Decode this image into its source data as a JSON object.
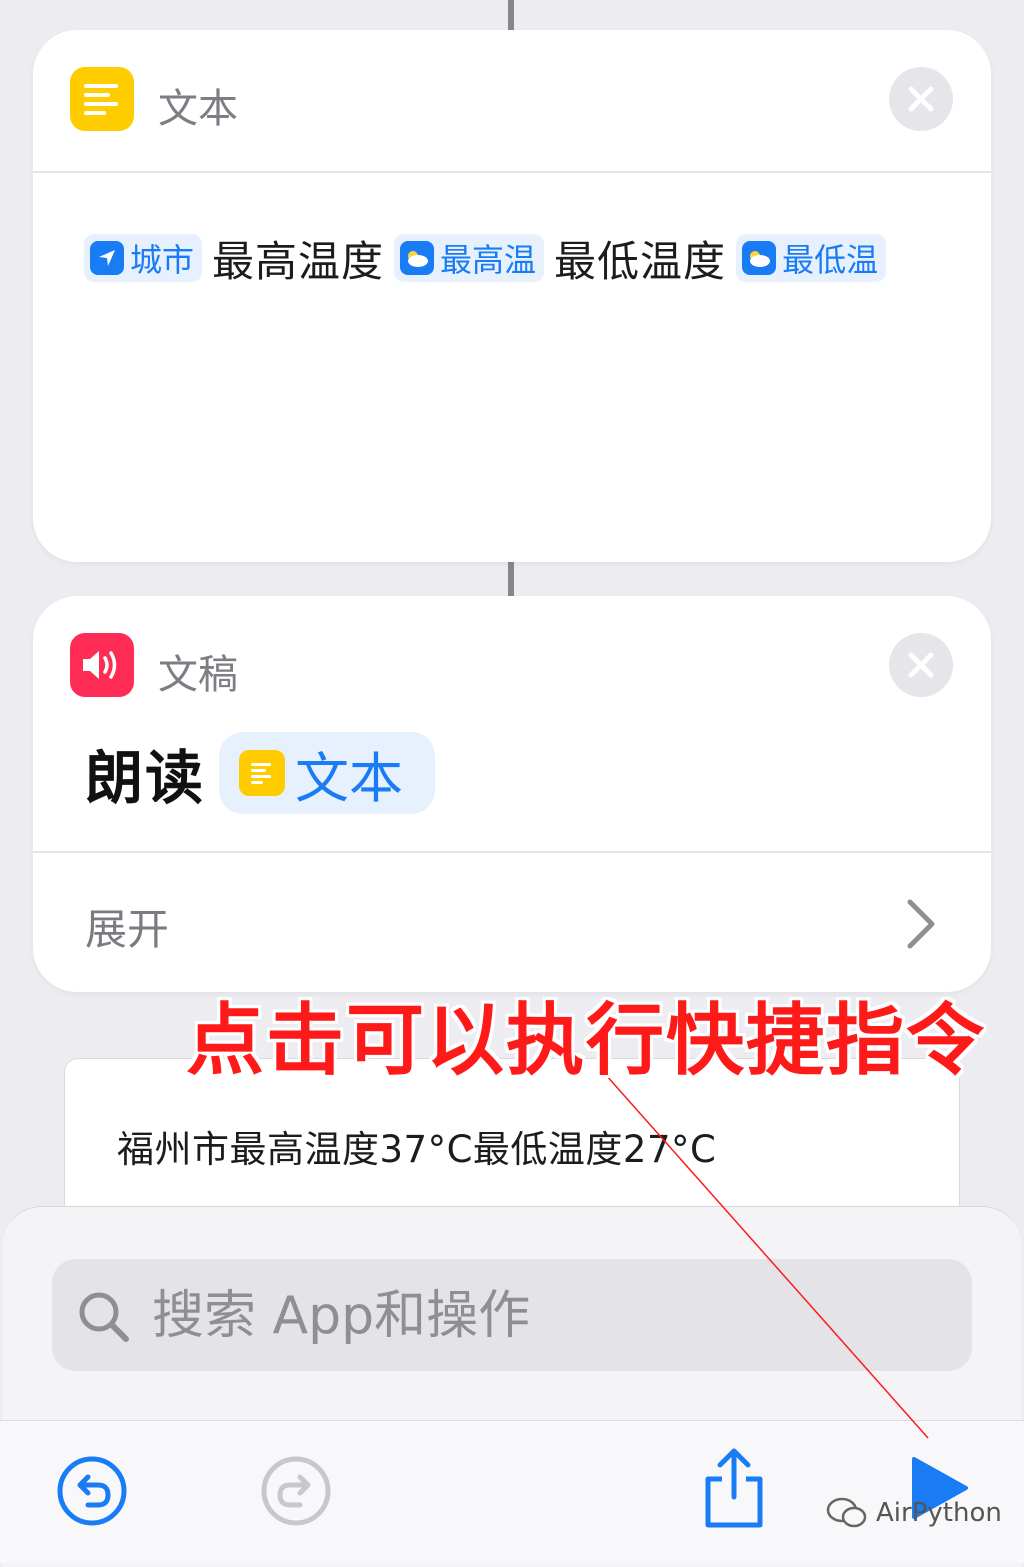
{
  "text_action": {
    "title": "文本",
    "tokens": [
      {
        "type": "chip",
        "icon": "location-arrow-icon",
        "label": "城市"
      },
      {
        "type": "text",
        "label": "最高温度"
      },
      {
        "type": "chip",
        "icon": "weather-icon",
        "label": "最高温"
      },
      {
        "type": "text",
        "label": "最低温度"
      },
      {
        "type": "chip",
        "icon": "weather-icon",
        "label": "最低温"
      }
    ]
  },
  "speak_action": {
    "title": "文稿",
    "verb": "朗读",
    "variable": "文本",
    "expand_label": "展开"
  },
  "annotation": "点击可以执行快捷指令",
  "result": {
    "text": "福州市最高温度37°C最低温度27°C"
  },
  "search": {
    "placeholder": "搜索 App和操作"
  },
  "toolbar": {
    "icons": [
      "undo-icon",
      "redo-icon",
      "share-icon",
      "play-icon"
    ]
  },
  "watermark": "AirPython",
  "colors": {
    "accent": "#1a7cf5",
    "text_icon": "#ffcc00",
    "speak_icon": "#ff2d55",
    "annotation": "#ff1a1a"
  }
}
